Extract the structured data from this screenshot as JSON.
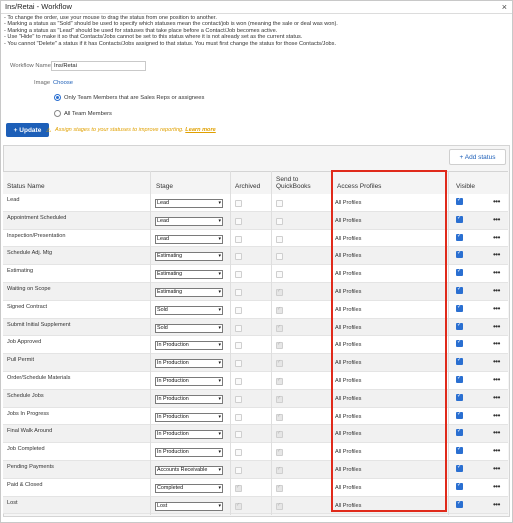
{
  "window": {
    "title": "Ins/Retai - Workflow",
    "close_label": "×"
  },
  "instructions": [
    "- To change the order, use your mouse to drag the status from one position to another.",
    "- Marking a status as \"Sold\" should be used to specify which statuses mean the contact/job is won (meaning the sale or deal was won).",
    "- Marking a status as \"Lead\" should be used for statuses that take place before a Contact/Job becomes active.",
    "- Use \"Hide\" to make it so that Contacts/Jobs cannot be set to this status where it is not already set as the current status.",
    "- You cannot \"Delete\" a status if it has Contacts/Jobs assigned to that status. You must first change the status for those Contacts/Jobs."
  ],
  "form": {
    "workflow_name_label": "Workflow Name",
    "workflow_name_value": "Ins/Retai",
    "image_label": "Image",
    "choose_label": "Choose",
    "radio_options": [
      {
        "label": "Only Team Members that are Sales Reps or assignees",
        "checked": true
      },
      {
        "label": "All Team Members",
        "checked": false
      }
    ]
  },
  "update_button": "+ Update",
  "hint": {
    "text": "Assign stages to your statuses to improve reporting.",
    "link": "Learn more",
    "icon": "warning-icon"
  },
  "add_status_button": "+ Add status",
  "columns": {
    "status_name": "Status Name",
    "stage": "Stage",
    "archived": "Archived",
    "send_to_qb_1": "Send to",
    "send_to_qb_2": "QuickBooks",
    "access_profiles": "Access Profiles",
    "visible": "Visible"
  },
  "rows": [
    {
      "name": "Lead",
      "stage": "Lead",
      "archived": false,
      "qb": false,
      "access": "All Profiles",
      "visible": true
    },
    {
      "name": "Appointment Scheduled",
      "stage": "Lead",
      "archived": false,
      "qb": false,
      "access": "All Profiles",
      "visible": true
    },
    {
      "name": "Inspection/Presentation",
      "stage": "Lead",
      "archived": false,
      "qb": false,
      "access": "All Profiles",
      "visible": true
    },
    {
      "name": "Schedule Adj. Mtg",
      "stage": "Estimating",
      "archived": false,
      "qb": false,
      "access": "All Profiles",
      "visible": true
    },
    {
      "name": "Estimating",
      "stage": "Estimating",
      "archived": false,
      "qb": false,
      "access": "All Profiles",
      "visible": true
    },
    {
      "name": "Waiting on Scope",
      "stage": "Estimating",
      "archived": false,
      "qb": true,
      "access": "All Profiles",
      "visible": true
    },
    {
      "name": "Signed Contract",
      "stage": "Sold",
      "archived": false,
      "qb": true,
      "access": "All Profiles",
      "visible": true
    },
    {
      "name": "Submit Initial Supplement",
      "stage": "Sold",
      "archived": false,
      "qb": true,
      "access": "All Profiles",
      "visible": true
    },
    {
      "name": "Job Approved",
      "stage": "In Production",
      "archived": false,
      "qb": true,
      "access": "All Profiles",
      "visible": true
    },
    {
      "name": "Pull Permit",
      "stage": "In Production",
      "archived": false,
      "qb": true,
      "access": "All Profiles",
      "visible": true
    },
    {
      "name": "Order/Schedule Materials",
      "stage": "In Production",
      "archived": false,
      "qb": true,
      "access": "All Profiles",
      "visible": true
    },
    {
      "name": "Schedule Jobs",
      "stage": "In Production",
      "archived": false,
      "qb": true,
      "access": "All Profiles",
      "visible": true
    },
    {
      "name": "Jobs In Progress",
      "stage": "In Production",
      "archived": false,
      "qb": true,
      "access": "All Profiles",
      "visible": true
    },
    {
      "name": "Final Walk Around",
      "stage": "In Production",
      "archived": false,
      "qb": true,
      "access": "All Profiles",
      "visible": true
    },
    {
      "name": "Job Completed",
      "stage": "In Production",
      "archived": false,
      "qb": true,
      "access": "All Profiles",
      "visible": true
    },
    {
      "name": "Pending Payments",
      "stage": "Accounts Receivable",
      "archived": false,
      "qb": true,
      "access": "All Profiles",
      "visible": true
    },
    {
      "name": "Paid & Closed",
      "stage": "Completed",
      "archived": true,
      "qb": true,
      "access": "All Profiles",
      "visible": true
    },
    {
      "name": "Lost",
      "stage": "Lost",
      "archived": true,
      "qb": true,
      "access": "All Profiles",
      "visible": true
    }
  ],
  "more_icon": "more-horizontal-icon",
  "colors": {
    "accent": "#1d5fb8",
    "highlight": "#e02a1b",
    "hint": "#e0a000"
  }
}
